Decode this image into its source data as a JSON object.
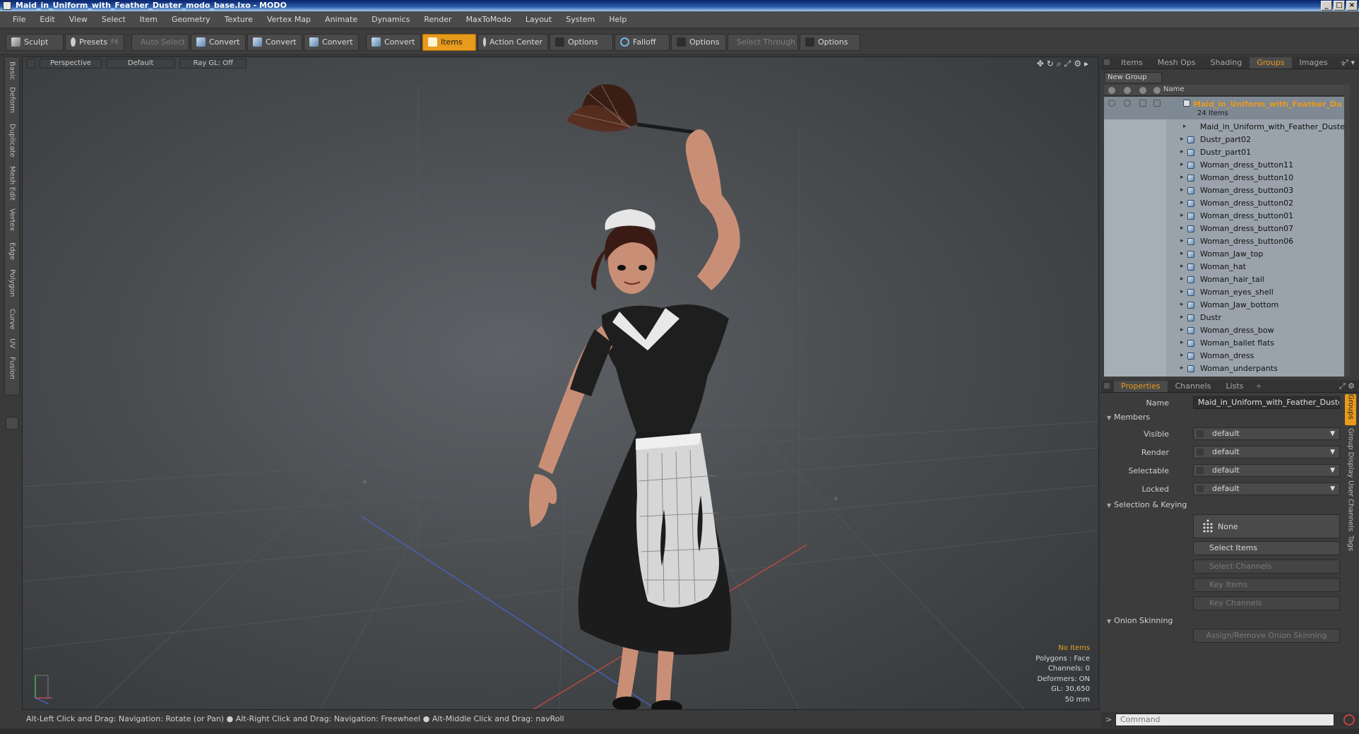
{
  "window": {
    "title": "Maid_in_Uniform_with_Feather_Duster_modo_base.lxo - MODO",
    "buttons": [
      "_",
      "□",
      "×"
    ]
  },
  "menu": [
    "File",
    "Edit",
    "View",
    "Select",
    "Item",
    "Geometry",
    "Texture",
    "Vertex Map",
    "Animate",
    "Dynamics",
    "Render",
    "MaxToModo",
    "Layout",
    "System",
    "Help"
  ],
  "toolbar": {
    "sculpt": "Sculpt",
    "presets": "Presets",
    "presets_hint": "F6",
    "auto_select": "Auto Select",
    "convert1": "Convert",
    "convert2": "Convert",
    "convert3": "Convert",
    "convert4": "Convert",
    "items": "Items",
    "action_center": "Action Center",
    "options1": "Options",
    "falloff": "Falloff",
    "options2": "Options",
    "select_through": "Select Through",
    "options3": "Options"
  },
  "left_tabs": [
    "Basic",
    "Deform",
    "Duplicate",
    "Mesh Edit",
    "Vertex",
    "Edge",
    "Polygon",
    "Curve",
    "UV",
    "Fusion"
  ],
  "viewport": {
    "view": "Perspective",
    "shading": "Default",
    "raygl": "Ray GL: Off",
    "info": {
      "items": "No Items",
      "polygons": "Polygons : Face",
      "channels": "Channels: 0",
      "deformers": "Deformers: ON",
      "gl": "GL: 30,650",
      "unit": "50 mm"
    }
  },
  "statusbar": "Alt-Left Click and Drag: Navigation: Rotate (or Pan) ● Alt-Right Click and Drag: Navigation: Freewheel ● Alt-Middle Click and Drag: navRoll",
  "top_tabs": [
    {
      "label": "Items",
      "selected": false
    },
    {
      "label": "Mesh Ops",
      "selected": false
    },
    {
      "label": "Shading",
      "selected": false
    },
    {
      "label": "Groups",
      "selected": true
    },
    {
      "label": "Images",
      "selected": false
    },
    {
      "label": "+",
      "selected": false
    }
  ],
  "groups": {
    "new_group": "New Group",
    "col_name": "Name",
    "group_name": "Maid_in_Uniform_with_Feather_Du ...",
    "group_count": "24 Items",
    "items": [
      "Maid_in_Uniform_with_Feather_Duster",
      "Dustr_part02",
      "Dustr_part01",
      "Woman_dress_button11",
      "Woman_dress_button10",
      "Woman_dress_button03",
      "Woman_dress_button02",
      "Woman_dress_button01",
      "Woman_dress_button07",
      "Woman_dress_button06",
      "Woman_Jaw_top",
      "Woman_hat",
      "Woman_hair_tail",
      "Woman_eyes_shell",
      "Woman_Jaw_bottom",
      "Dustr",
      "Woman_dress_bow",
      "Woman_ballet flats",
      "Woman_dress",
      "Woman_underpants"
    ]
  },
  "bottom_tabs": [
    {
      "label": "Properties",
      "selected": true
    },
    {
      "label": "Channels",
      "selected": false
    },
    {
      "label": "Lists",
      "selected": false
    },
    {
      "label": "+",
      "selected": false
    }
  ],
  "properties": {
    "name_label": "Name",
    "name_value": "Maid_in_Uniform_with_Feather_Duster (",
    "members": "Members",
    "visible_label": "Visible",
    "visible_value": "default",
    "render_label": "Render",
    "render_value": "default",
    "selectable_label": "Selectable",
    "selectable_value": "default",
    "locked_label": "Locked",
    "locked_value": "default",
    "selection_keying": "Selection & Keying",
    "none": "None",
    "select_items": "Select Items",
    "select_channels": "Select Channels",
    "key_items": "Key Items",
    "key_channels": "Key Channels",
    "onion_skinning": "Onion Skinning",
    "assign_onion": "Assign/Remove Onion Skinning"
  },
  "right_vtabs": [
    "Groups",
    "Group Display",
    "User Channels",
    "Tags"
  ],
  "command": {
    "prompt": ">",
    "placeholder": "Command"
  },
  "colors": {
    "accent": "#e89a1c",
    "group_title": "#e89a1c"
  }
}
